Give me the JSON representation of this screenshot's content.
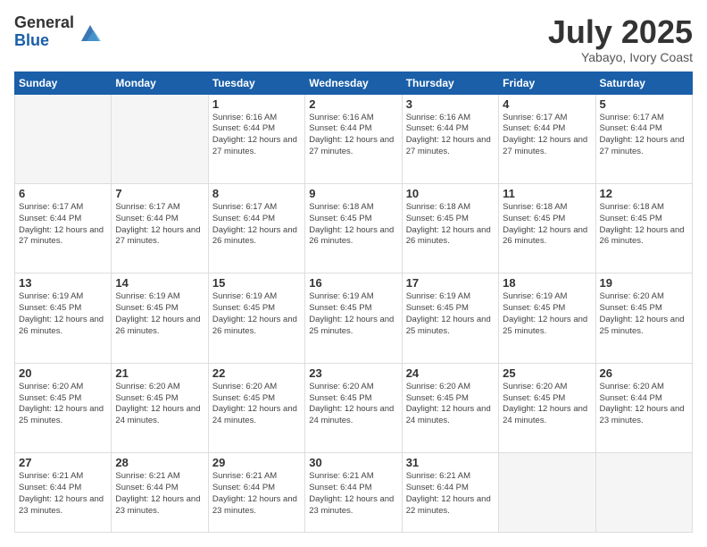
{
  "logo": {
    "general": "General",
    "blue": "Blue"
  },
  "header": {
    "month": "July 2025",
    "location": "Yabayo, Ivory Coast"
  },
  "weekdays": [
    "Sunday",
    "Monday",
    "Tuesday",
    "Wednesday",
    "Thursday",
    "Friday",
    "Saturday"
  ],
  "weeks": [
    [
      {
        "day": "",
        "empty": true
      },
      {
        "day": "",
        "empty": true
      },
      {
        "day": "1",
        "sunrise": "6:16 AM",
        "sunset": "6:44 PM",
        "daylight": "12 hours and 27 minutes."
      },
      {
        "day": "2",
        "sunrise": "6:16 AM",
        "sunset": "6:44 PM",
        "daylight": "12 hours and 27 minutes."
      },
      {
        "day": "3",
        "sunrise": "6:16 AM",
        "sunset": "6:44 PM",
        "daylight": "12 hours and 27 minutes."
      },
      {
        "day": "4",
        "sunrise": "6:17 AM",
        "sunset": "6:44 PM",
        "daylight": "12 hours and 27 minutes."
      },
      {
        "day": "5",
        "sunrise": "6:17 AM",
        "sunset": "6:44 PM",
        "daylight": "12 hours and 27 minutes."
      }
    ],
    [
      {
        "day": "6",
        "sunrise": "6:17 AM",
        "sunset": "6:44 PM",
        "daylight": "12 hours and 27 minutes."
      },
      {
        "day": "7",
        "sunrise": "6:17 AM",
        "sunset": "6:44 PM",
        "daylight": "12 hours and 27 minutes."
      },
      {
        "day": "8",
        "sunrise": "6:17 AM",
        "sunset": "6:44 PM",
        "daylight": "12 hours and 26 minutes."
      },
      {
        "day": "9",
        "sunrise": "6:18 AM",
        "sunset": "6:45 PM",
        "daylight": "12 hours and 26 minutes."
      },
      {
        "day": "10",
        "sunrise": "6:18 AM",
        "sunset": "6:45 PM",
        "daylight": "12 hours and 26 minutes."
      },
      {
        "day": "11",
        "sunrise": "6:18 AM",
        "sunset": "6:45 PM",
        "daylight": "12 hours and 26 minutes."
      },
      {
        "day": "12",
        "sunrise": "6:18 AM",
        "sunset": "6:45 PM",
        "daylight": "12 hours and 26 minutes."
      }
    ],
    [
      {
        "day": "13",
        "sunrise": "6:19 AM",
        "sunset": "6:45 PM",
        "daylight": "12 hours and 26 minutes."
      },
      {
        "day": "14",
        "sunrise": "6:19 AM",
        "sunset": "6:45 PM",
        "daylight": "12 hours and 26 minutes."
      },
      {
        "day": "15",
        "sunrise": "6:19 AM",
        "sunset": "6:45 PM",
        "daylight": "12 hours and 26 minutes."
      },
      {
        "day": "16",
        "sunrise": "6:19 AM",
        "sunset": "6:45 PM",
        "daylight": "12 hours and 25 minutes."
      },
      {
        "day": "17",
        "sunrise": "6:19 AM",
        "sunset": "6:45 PM",
        "daylight": "12 hours and 25 minutes."
      },
      {
        "day": "18",
        "sunrise": "6:19 AM",
        "sunset": "6:45 PM",
        "daylight": "12 hours and 25 minutes."
      },
      {
        "day": "19",
        "sunrise": "6:20 AM",
        "sunset": "6:45 PM",
        "daylight": "12 hours and 25 minutes."
      }
    ],
    [
      {
        "day": "20",
        "sunrise": "6:20 AM",
        "sunset": "6:45 PM",
        "daylight": "12 hours and 25 minutes."
      },
      {
        "day": "21",
        "sunrise": "6:20 AM",
        "sunset": "6:45 PM",
        "daylight": "12 hours and 24 minutes."
      },
      {
        "day": "22",
        "sunrise": "6:20 AM",
        "sunset": "6:45 PM",
        "daylight": "12 hours and 24 minutes."
      },
      {
        "day": "23",
        "sunrise": "6:20 AM",
        "sunset": "6:45 PM",
        "daylight": "12 hours and 24 minutes."
      },
      {
        "day": "24",
        "sunrise": "6:20 AM",
        "sunset": "6:45 PM",
        "daylight": "12 hours and 24 minutes."
      },
      {
        "day": "25",
        "sunrise": "6:20 AM",
        "sunset": "6:45 PM",
        "daylight": "12 hours and 24 minutes."
      },
      {
        "day": "26",
        "sunrise": "6:20 AM",
        "sunset": "6:44 PM",
        "daylight": "12 hours and 23 minutes."
      }
    ],
    [
      {
        "day": "27",
        "sunrise": "6:21 AM",
        "sunset": "6:44 PM",
        "daylight": "12 hours and 23 minutes."
      },
      {
        "day": "28",
        "sunrise": "6:21 AM",
        "sunset": "6:44 PM",
        "daylight": "12 hours and 23 minutes."
      },
      {
        "day": "29",
        "sunrise": "6:21 AM",
        "sunset": "6:44 PM",
        "daylight": "12 hours and 23 minutes."
      },
      {
        "day": "30",
        "sunrise": "6:21 AM",
        "sunset": "6:44 PM",
        "daylight": "12 hours and 23 minutes."
      },
      {
        "day": "31",
        "sunrise": "6:21 AM",
        "sunset": "6:44 PM",
        "daylight": "12 hours and 22 minutes."
      },
      {
        "day": "",
        "empty": true
      },
      {
        "day": "",
        "empty": true
      }
    ]
  ]
}
